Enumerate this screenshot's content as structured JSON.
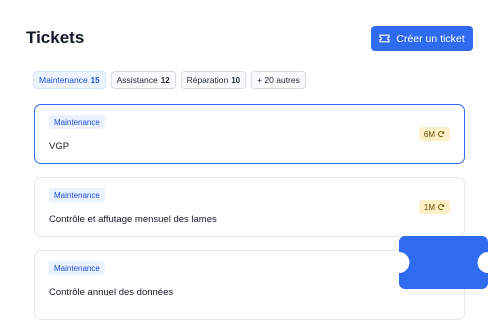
{
  "header": {
    "title": "Tickets",
    "create_label": "Créer un ticket"
  },
  "filters": [
    {
      "label": "Maintenance",
      "count": "15",
      "active": true
    },
    {
      "label": "Assistance",
      "count": "12",
      "active": false
    },
    {
      "label": "Réparation",
      "count": "10",
      "active": false
    },
    {
      "label": "+ 20 autres",
      "count": "",
      "active": false
    }
  ],
  "tickets": [
    {
      "category": "Maintenance",
      "name": "VGP",
      "frequency": "6M",
      "selected": true
    },
    {
      "category": "Maintenance",
      "name": "Contrôle et affutage mensuel des lames",
      "frequency": "1M",
      "selected": false
    },
    {
      "category": "Maintenance",
      "name": "Contrôle annuel des données",
      "frequency": "",
      "selected": false
    }
  ],
  "colors": {
    "accent": "#2f6bf0",
    "tag_bg": "#eaf1ff",
    "freq_bg": "#fdf0c8"
  },
  "icons": {
    "create": "ticket-icon",
    "frequency": "repeat-icon",
    "decoration": "ticket-icon"
  }
}
